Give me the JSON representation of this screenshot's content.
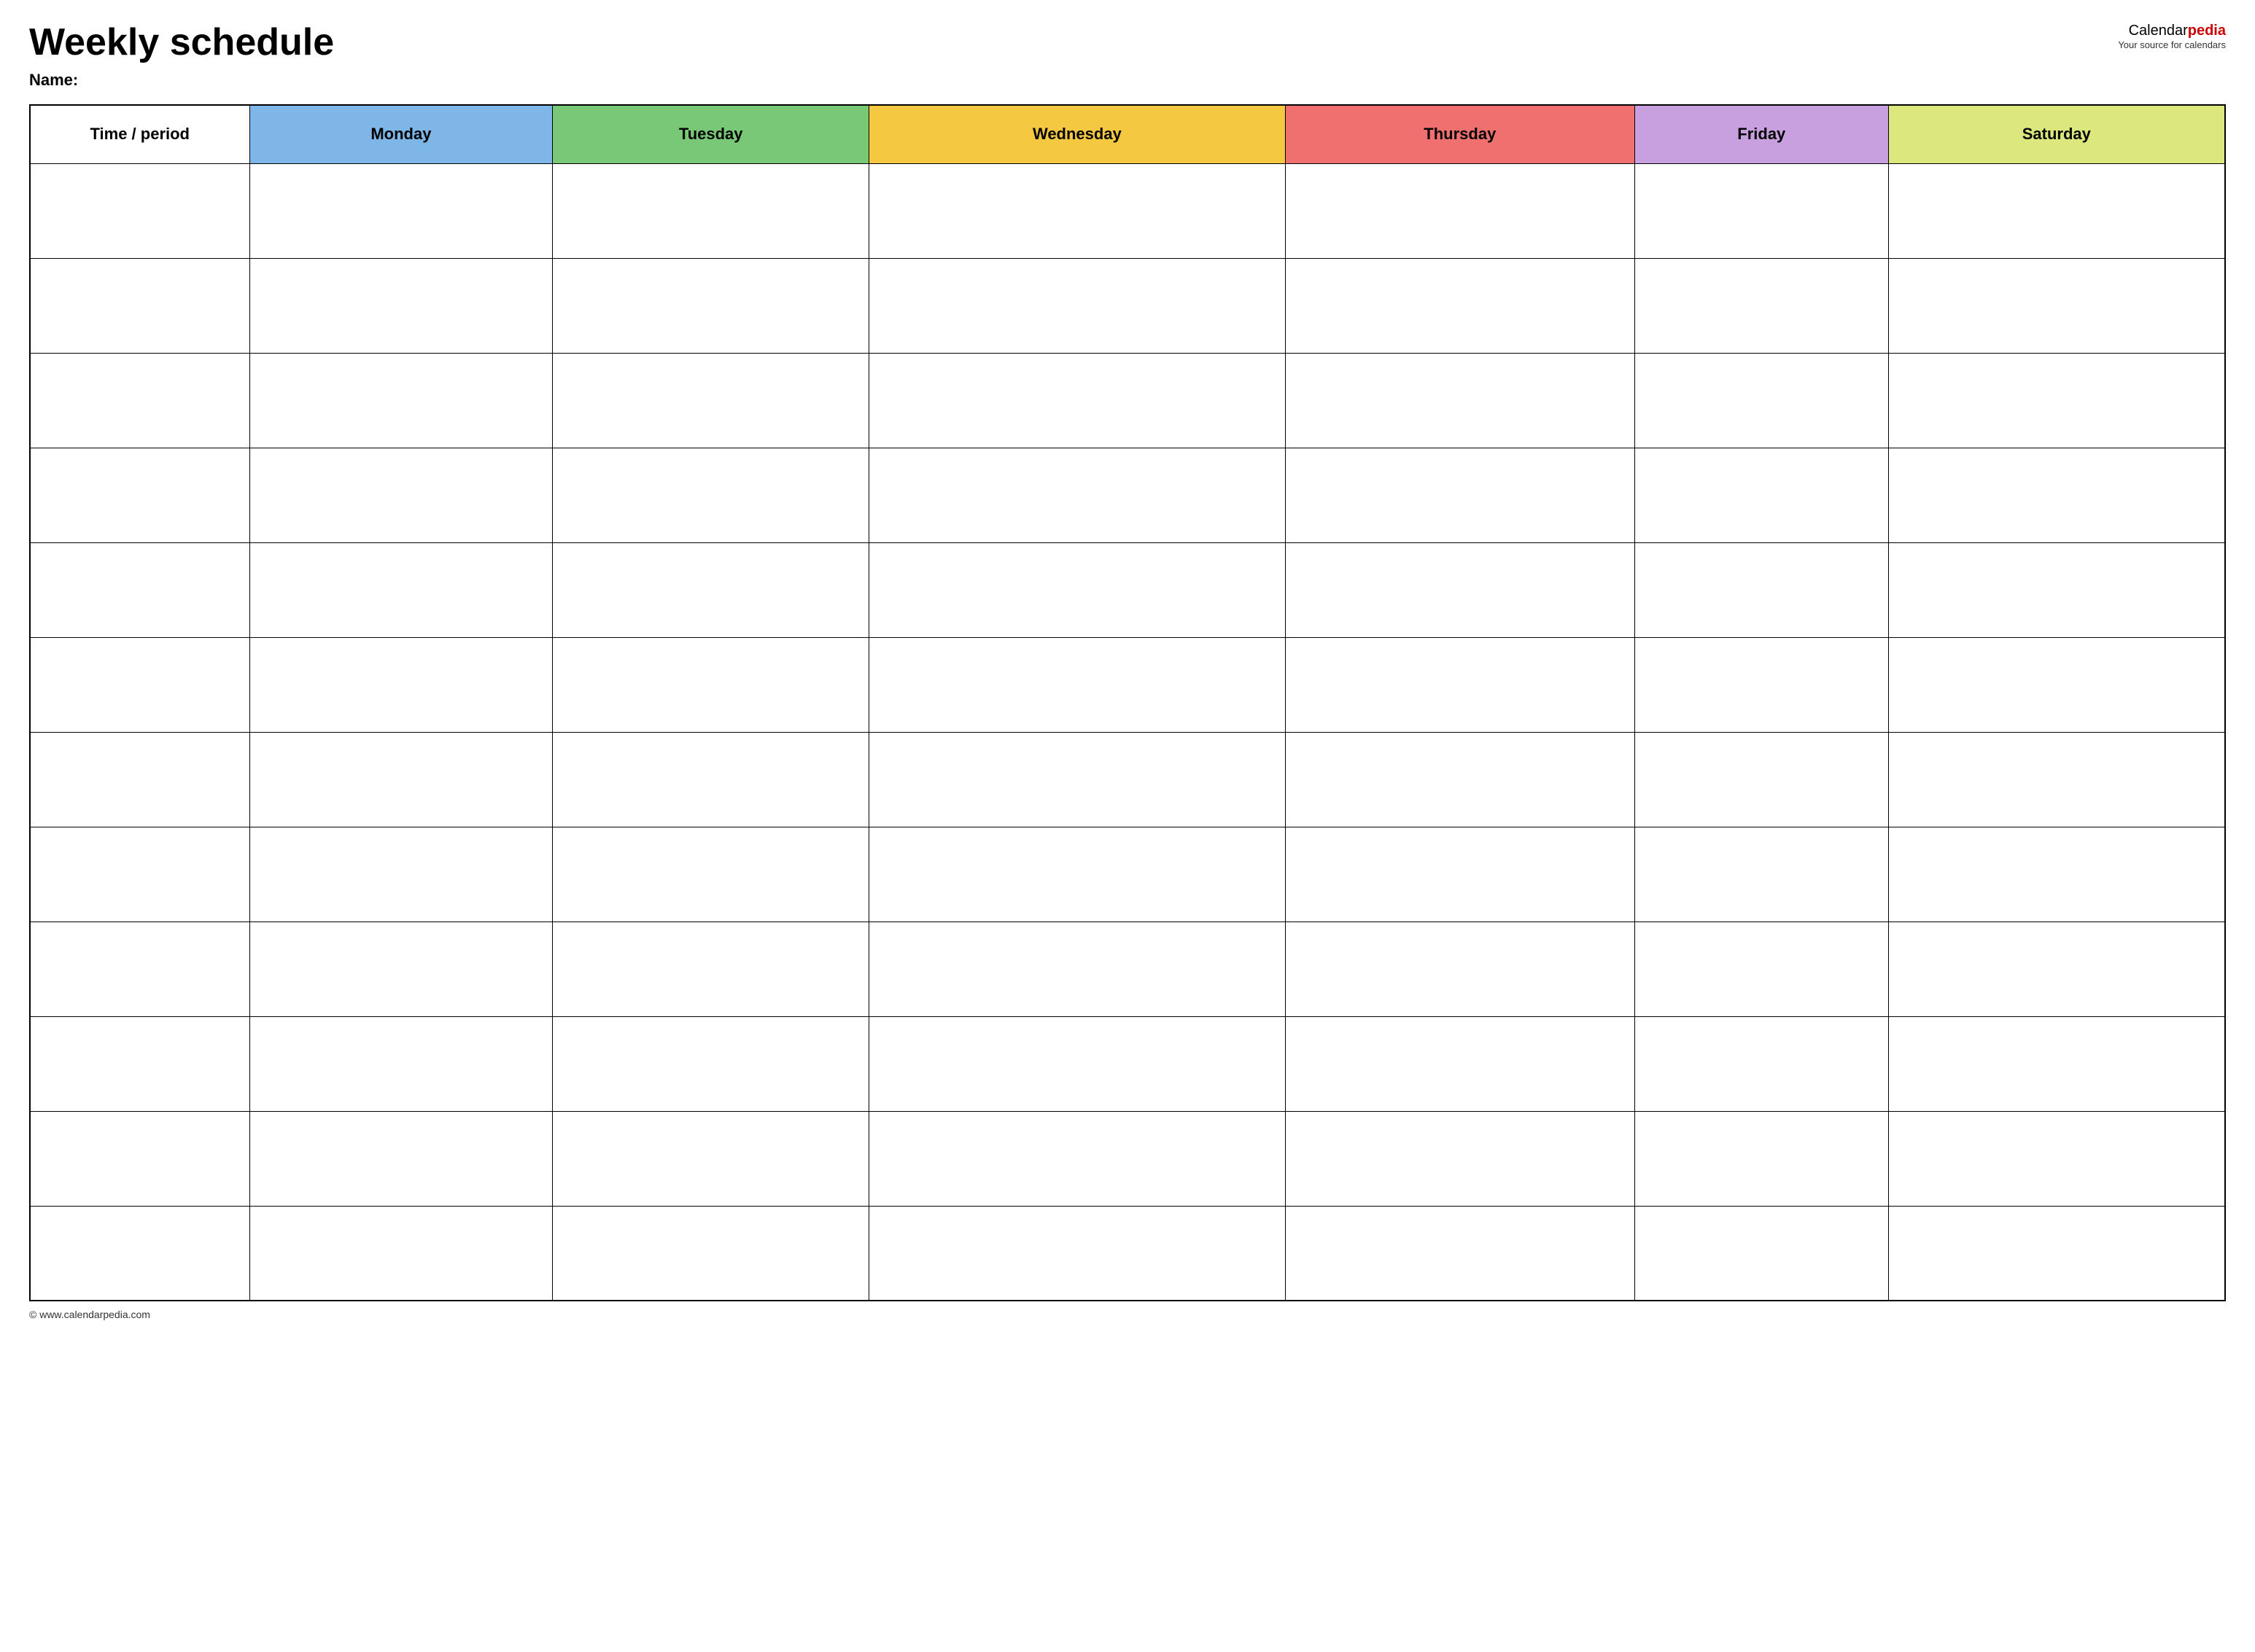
{
  "header": {
    "title": "Weekly schedule",
    "name_label": "Name:",
    "logo": {
      "calendar_part": "Calendar",
      "pedia_part": "pedia",
      "tagline": "Your source for calendars"
    }
  },
  "table": {
    "columns": [
      {
        "id": "time",
        "label": "Time / period",
        "class": "col-time"
      },
      {
        "id": "monday",
        "label": "Monday",
        "class": "col-monday"
      },
      {
        "id": "tuesday",
        "label": "Tuesday",
        "class": "col-tuesday"
      },
      {
        "id": "wednesday",
        "label": "Wednesday",
        "class": "col-wednesday"
      },
      {
        "id": "thursday",
        "label": "Thursday",
        "class": "col-thursday"
      },
      {
        "id": "friday",
        "label": "Friday",
        "class": "col-friday"
      },
      {
        "id": "saturday",
        "label": "Saturday",
        "class": "col-saturday"
      }
    ],
    "row_count": 12
  },
  "footer": {
    "url": "© www.calendarpedia.com"
  }
}
